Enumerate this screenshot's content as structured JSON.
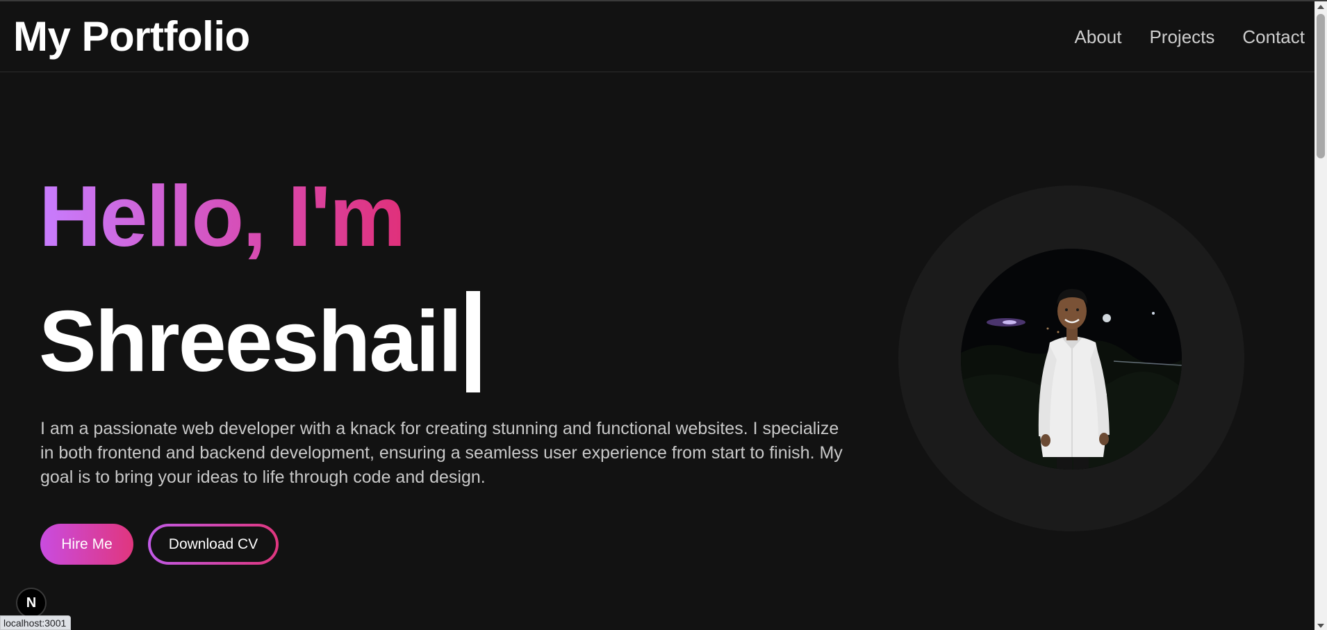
{
  "navbar": {
    "brand": "My Portfolio",
    "links": [
      "About",
      "Projects",
      "Contact"
    ]
  },
  "hero": {
    "greeting": "Hello, I'm",
    "name": "Shreeshail",
    "description": "I am a passionate web developer with a knack for creating stunning and functional websites. I specialize in both frontend and backend development, ensuring a seamless user experience from start to finish. My goal is to bring your ideas to life through code and design.",
    "primary_button": "Hire Me",
    "secondary_button": "Download CV"
  },
  "badge": {
    "letter": "N"
  },
  "status_bar": {
    "url": "localhost:3001"
  },
  "colors": {
    "background": "#121212",
    "accent_start": "#c77dff",
    "accent_end": "#e0307a"
  }
}
